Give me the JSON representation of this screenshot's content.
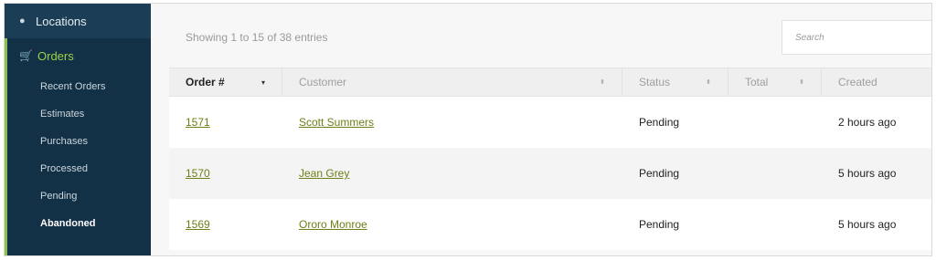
{
  "sidebar": {
    "locations_label": "Locations",
    "orders_label": "Orders",
    "items": [
      {
        "label": "Recent Orders"
      },
      {
        "label": "Estimates"
      },
      {
        "label": "Purchases"
      },
      {
        "label": "Processed"
      },
      {
        "label": "Pending"
      },
      {
        "label": "Abandoned"
      }
    ],
    "active_item": "Abandoned",
    "accent_color": "#9bd14a",
    "background_color": "#123046"
  },
  "main": {
    "showing_text": "Showing 1 to 15 of 38 entries",
    "search_placeholder": "Search",
    "columns": [
      {
        "label": "Order #",
        "sorted": true,
        "sort_icon": "▾"
      },
      {
        "label": "Customer",
        "sort_icon": "⬍"
      },
      {
        "label": "Status",
        "sort_icon": "⬍"
      },
      {
        "label": "Total",
        "sort_icon": "⬍"
      },
      {
        "label": "Created",
        "sort_icon": ""
      }
    ],
    "rows": [
      {
        "order": "1571",
        "customer": "Scott Summers",
        "status": "Pending",
        "total": "",
        "created": "2 hours ago"
      },
      {
        "order": "1570",
        "customer": "Jean Grey ",
        "status": "Pending",
        "total": "",
        "created": "5 hours ago"
      },
      {
        "order": "1569",
        "customer": "Ororo Monroe",
        "status": "Pending",
        "total": "",
        "created": "5 hours ago"
      }
    ],
    "link_color": "#6f7e16"
  },
  "icons": {
    "locations": "map-marker-icon",
    "orders": "cart-icon"
  }
}
